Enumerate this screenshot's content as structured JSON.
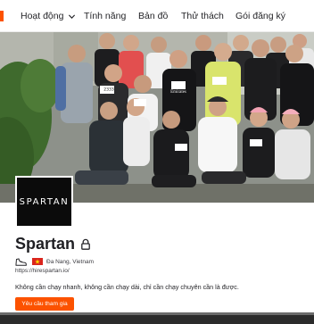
{
  "nav": {
    "items": [
      {
        "label": "Hoạt động",
        "has_dropdown": true
      },
      {
        "label": "Tính năng",
        "has_dropdown": false
      },
      {
        "label": "Bản đồ",
        "has_dropdown": false
      },
      {
        "label": "Thử thách",
        "has_dropdown": false
      },
      {
        "label": "Gói đăng ký",
        "has_dropdown": false
      }
    ],
    "dropdown_icon": "chevron-down-icon"
  },
  "cover": {
    "description_icon": "group-photo",
    "bib_left": "2333",
    "shirt_text": "Emirates"
  },
  "club": {
    "avatar_text": "SPARTAN",
    "name": "Spartan",
    "private_icon": "lock-icon",
    "sport_icon": "running-shoe-icon",
    "flag_icon": "vietnam-flag-icon",
    "location": "Đa Nang, Vietnam",
    "website": "https://hirespartan.io/",
    "description": "Không cần chạy nhanh, không cần chạy dài, chỉ cần chạy chuyên cần là được.",
    "join_label": "Yêu cầu tham gia"
  },
  "colors": {
    "accent": "#fc5200",
    "text": "#242428",
    "avatar_bg": "#0b0b0b",
    "flag_red": "#da251d",
    "flag_star": "#ffdd00"
  }
}
